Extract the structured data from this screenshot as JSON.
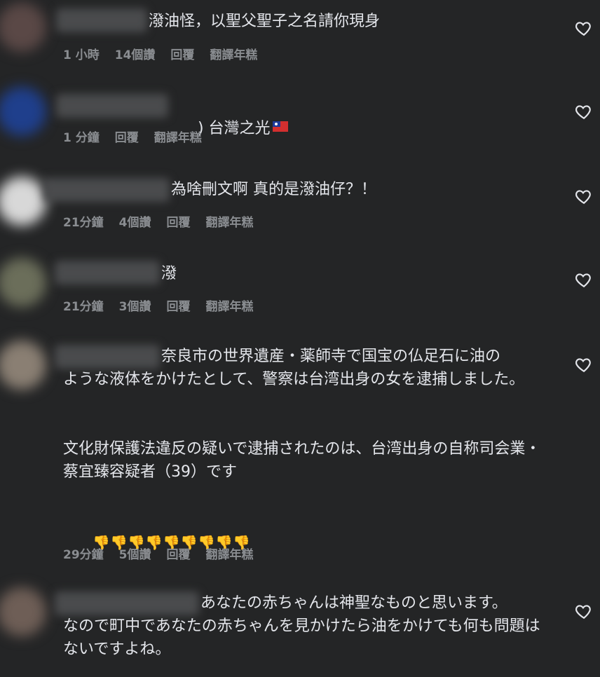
{
  "icons": {
    "like": "heart-outline-icon"
  },
  "colors": {
    "background": "#242526",
    "text": "#e4e6eb",
    "meta": "#8a8d91",
    "thumbs": "#f5c33b"
  },
  "comments": [
    {
      "text": "潑油怪，以聖父聖子之名請你現身",
      "meta": [
        "1 小時",
        "14個讚",
        "回覆",
        "翻譯年糕"
      ]
    },
    {
      "text": ") 台灣之光",
      "flag": "taiwan-flag-icon",
      "meta": [
        "1 分鐘",
        "回覆",
        "翻譯年糕"
      ]
    },
    {
      "text": "為啥刪文啊 真的是潑油仔？！",
      "meta": [
        "21分鐘",
        "4個讚",
        "回覆",
        "翻譯年糕"
      ]
    },
    {
      "text": "潑",
      "meta": [
        "21分鐘",
        "3個讚",
        "回覆",
        "翻譯年糕"
      ]
    },
    {
      "text_line1": "奈良市の世界遺産・薬師寺で国宝の仏足石に油の",
      "text_rest": "ような液体をかけたとして、警察は台湾出身の女を逮捕しました。",
      "text_para2": "文化財保護法違反の疑いで逮捕されたのは、台湾出身の自称司会業・蔡宜臻容疑者（39）です",
      "thumbs": [
        "👎",
        "👎",
        "👎",
        "👎",
        "👎",
        "👎",
        "👎",
        "👎",
        "👎"
      ],
      "meta": [
        "29分鐘",
        "5個讚",
        "回覆",
        "翻譯年糕"
      ]
    },
    {
      "text_line1": "あなたの赤ちゃんは神聖なものと思います。",
      "text_rest": "なので町中であなたの赤ちゃんを見かけたら油をかけても何も問題はないですよね。"
    }
  ]
}
